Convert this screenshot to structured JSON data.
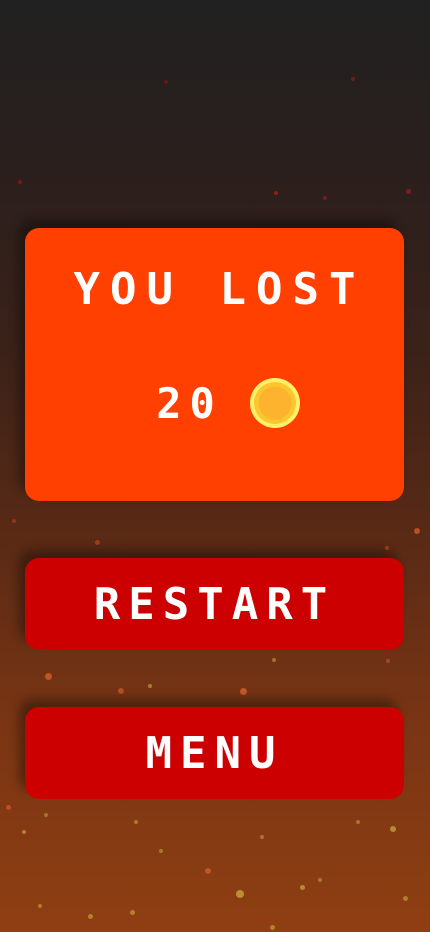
{
  "result": {
    "title": "YOU LOST",
    "coins": "20",
    "coin_icon": "gold-coin-icon"
  },
  "buttons": {
    "restart_label": "RESTART",
    "menu_label": "MENU"
  },
  "colors": {
    "card": "#ff4000",
    "button": "#cc0000",
    "text": "#ffffff",
    "coin": "#fdb32d"
  }
}
